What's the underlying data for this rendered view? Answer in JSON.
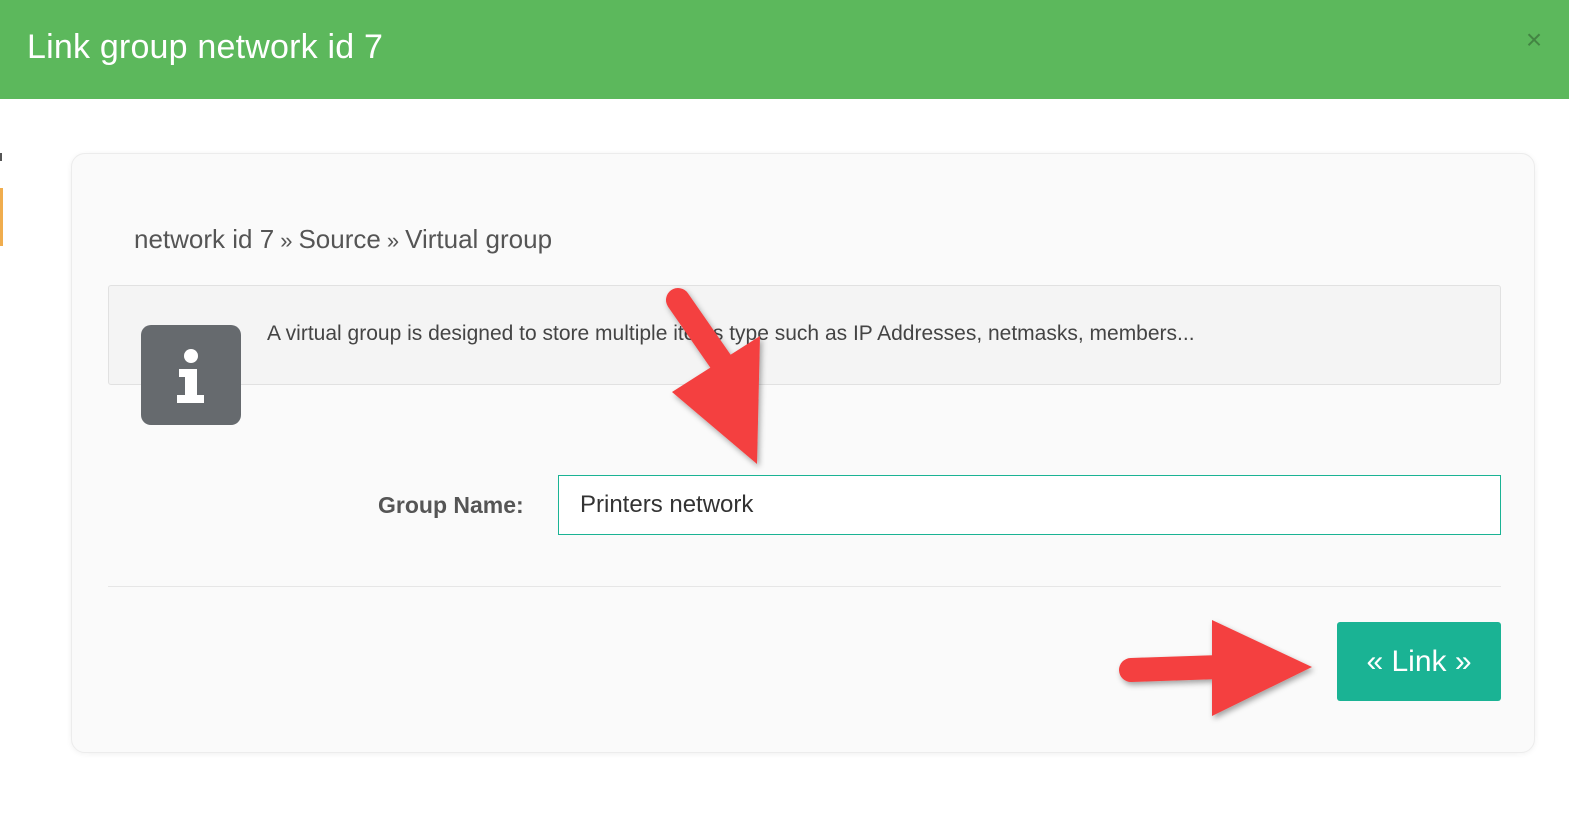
{
  "modal": {
    "title": "Link group network id 7",
    "close_label": "×"
  },
  "breadcrumb": {
    "items": [
      "network id 7",
      "Source",
      "Virtual group"
    ],
    "separator": "»"
  },
  "info": {
    "icon": "info-icon",
    "text": "A virtual group is designed to store multiple items type such as IP Addresses, netmasks, members..."
  },
  "form": {
    "group_name_label": "Group Name:",
    "group_name_value": "Printers network"
  },
  "actions": {
    "link_label": "« Link »"
  },
  "colors": {
    "header": "#5cb85c",
    "accent": "#1ab394",
    "annotation_arrow": "#f44040",
    "info_icon_bg": "#666a6e"
  }
}
